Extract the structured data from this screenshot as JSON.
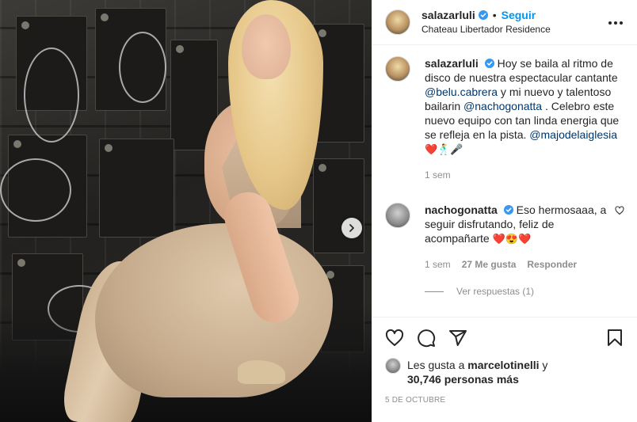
{
  "post": {
    "username": "salazarluli",
    "follow_label": "Seguir",
    "separator": "•",
    "location": "Chateau Libertador Residence"
  },
  "caption": {
    "username": "salazarluli",
    "text_1": "Hoy se baila al ritmo de disco de nuestra espectacular cantante ",
    "mention_1": "@belu.cabrera",
    "text_2": " y mi nuevo y talentoso bailarin ",
    "mention_2": "@nachogonatta",
    "text_3": " . Celebro este nuevo equipo con tan linda energia que se refleja en la pista. ",
    "mention_3": "@majodelaiglesia",
    "emojis": "❤️🕺🎤",
    "time": "1 sem"
  },
  "comment": {
    "username": "nachogonatta",
    "text": "Eso hermosaaa, a seguir disfrutando, feliz de acompañarte ",
    "emojis": "❤️😍❤️",
    "time": "1 sem",
    "likes": "27 Me gusta",
    "reply_label": "Responder",
    "view_replies": "Ver respuestas (1)"
  },
  "likes": {
    "prefix": "Les gusta a ",
    "user": "marcelotinelli",
    "suffix": " y",
    "count": "30,746 personas más"
  },
  "date": "5 DE OCTUBRE",
  "colors": {
    "accent": "#0095f6",
    "verified": "#3897f0",
    "mention": "#00376b",
    "muted": "#8e8e8e"
  },
  "icons": [
    "verified-icon",
    "more-options-icon",
    "heart-icon",
    "comment-icon",
    "share-icon",
    "save-icon",
    "next-arrow-icon",
    "like-comment-icon"
  ]
}
